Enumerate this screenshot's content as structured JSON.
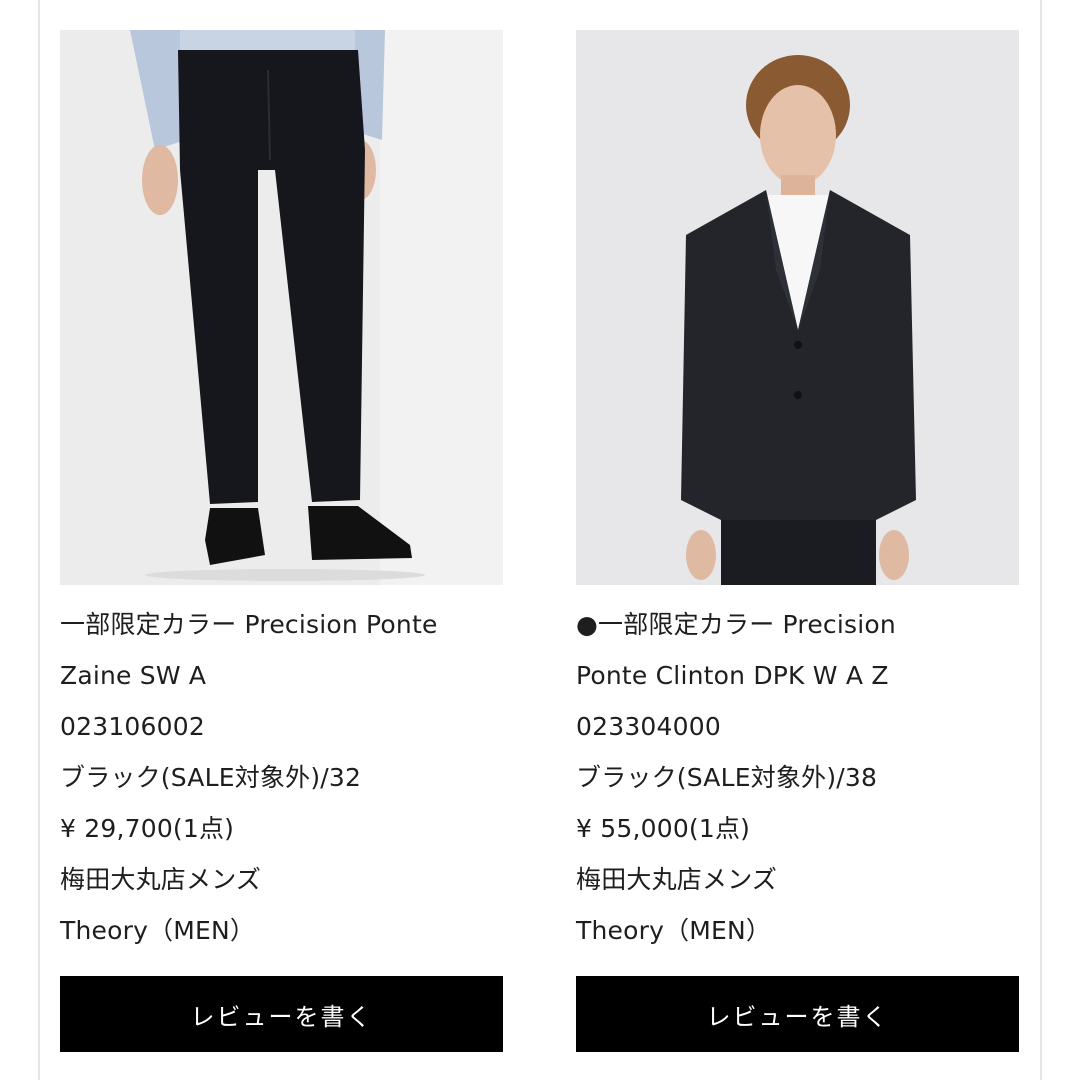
{
  "products": [
    {
      "title_line1": "一部限定カラー Precision Ponte",
      "title_line2": "Zaine SW A",
      "code": "023106002",
      "color_size": "ブラック(SALE対象外)/32",
      "price": "¥ 29,700(1点)",
      "store": "梅田大丸店メンズ",
      "brand": "Theory（MEN）",
      "button_label": "レビューを書く",
      "image": "model-wearing-black-slim-trousers"
    },
    {
      "title_line1": "●一部限定カラー Precision",
      "title_line2": "Ponte Clinton DPK W A Z",
      "code": "023304000",
      "color_size": "ブラック(SALE対象外)/38",
      "price": "¥ 55,000(1点)",
      "store": "梅田大丸店メンズ",
      "brand": "Theory（MEN）",
      "button_label": "レビューを書く",
      "image": "model-wearing-black-blazer"
    }
  ],
  "colors": {
    "button_bg": "#000000",
    "button_text": "#ffffff",
    "text": "#1e1e1e",
    "photo_bg": "#efefef"
  }
}
